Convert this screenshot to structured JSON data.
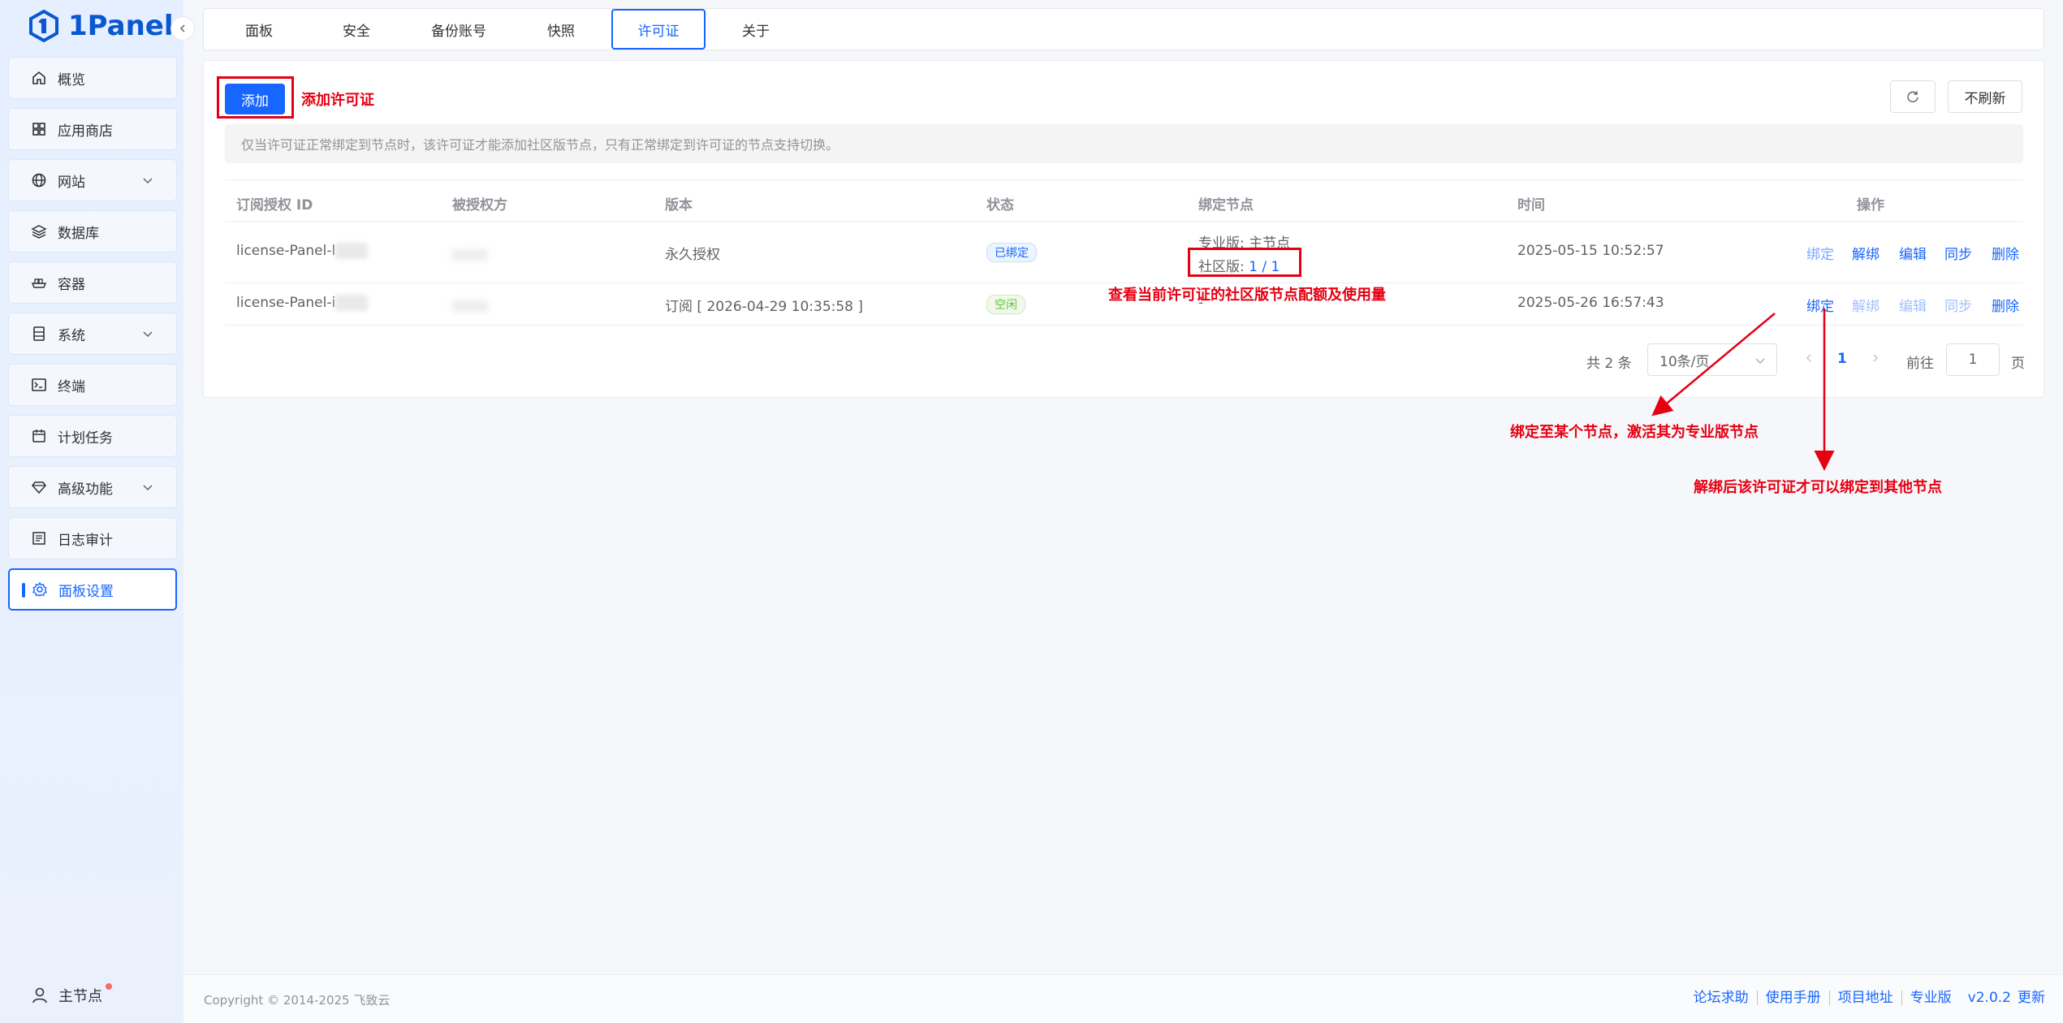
{
  "app": {
    "logo_text": "1Panel"
  },
  "sidebar": {
    "items": [
      {
        "label": "概览",
        "icon": "home-icon"
      },
      {
        "label": "应用商店",
        "icon": "apps-grid-icon"
      },
      {
        "label": "网站",
        "icon": "globe-icon",
        "expandable": true
      },
      {
        "label": "数据库",
        "icon": "layers-icon"
      },
      {
        "label": "容器",
        "icon": "container-ship-icon"
      },
      {
        "label": "系统",
        "icon": "server-icon",
        "expandable": true
      },
      {
        "label": "终端",
        "icon": "terminal-icon"
      },
      {
        "label": "计划任务",
        "icon": "calendar-icon"
      },
      {
        "label": "高级功能",
        "icon": "diamond-icon",
        "expandable": true
      },
      {
        "label": "日志审计",
        "icon": "log-list-icon"
      },
      {
        "label": "面板设置",
        "icon": "gear-icon",
        "active": true
      }
    ],
    "node_label": "主节点"
  },
  "tabs": [
    "面板",
    "安全",
    "备份账号",
    "快照",
    "许可证",
    "关于"
  ],
  "active_tab": "许可证",
  "toolbar": {
    "add_label": "添加",
    "add_annotation": "添加许可证",
    "refresh_icon": "refresh-icon",
    "no_refresh_label": "不刷新"
  },
  "notice": "仅当许可证正常绑定到节点时，该许可证才能添加社区版节点，只有正常绑定到许可证的节点支持切换。",
  "table": {
    "headers": [
      "订阅授权 ID",
      "被授权方",
      "版本",
      "状态",
      "绑定节点",
      "时间",
      "操作"
    ],
    "rows": [
      {
        "id": "license-Panel-l",
        "licensee": "",
        "version": "永久授权",
        "status": "已绑定",
        "node_pro": "专业版: 主节点",
        "node_community_label": "社区版:",
        "node_community_value": "1 / 1",
        "time": "2025-05-15 10:52:57",
        "ops": [
          "绑定",
          "解绑",
          "编辑",
          "同步",
          "删除"
        ]
      },
      {
        "id": "license-Panel-i",
        "licensee": "",
        "version": "订阅 [ 2026-04-29 10:35:58 ]",
        "status": "空闲",
        "node": "-",
        "time": "2025-05-26 16:57:43",
        "ops": [
          "绑定",
          "解绑",
          "编辑",
          "同步",
          "删除"
        ]
      }
    ]
  },
  "pagination": {
    "total": "共 2 条",
    "page_size": "10条/页",
    "current": "1",
    "goto_label": "前往",
    "goto_value": "1",
    "page_suffix": "页"
  },
  "annotations": {
    "quota": "查看当前许可证的社区版节点配额及使用量",
    "bind": "绑定至某个节点，激活其为专业版节点",
    "unbind": "解绑后该许可证才可以绑定到其他节点"
  },
  "footer": {
    "copyright": "Copyright © 2014-2025 飞致云",
    "links": [
      "论坛求助",
      "使用手册",
      "项目地址",
      "专业版"
    ],
    "version": "v2.0.2",
    "update": "更新"
  },
  "colors": {
    "accent": "#1766ff",
    "annotation": "#e60012"
  }
}
